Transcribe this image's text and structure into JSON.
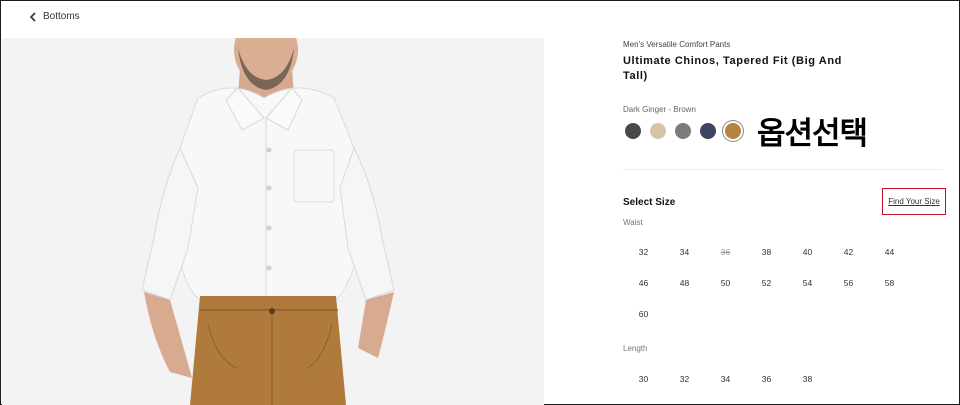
{
  "nav": {
    "back_label": "Bottoms"
  },
  "product": {
    "subtitle": "Men's Versatile Comfort Pants",
    "title": "Ultimate Chinos, Tapered Fit (Big And Tall)",
    "color_name": "Dark Ginger - Brown",
    "swatches": [
      {
        "name": "charcoal",
        "hex": "#46484b",
        "selected": false
      },
      {
        "name": "khaki",
        "hex": "#d6c3a6",
        "selected": false
      },
      {
        "name": "grey",
        "hex": "#7c7d7b",
        "selected": false
      },
      {
        "name": "navy",
        "hex": "#3d4460",
        "selected": false
      },
      {
        "name": "dark ginger",
        "hex": "#b5843f",
        "selected": true
      }
    ]
  },
  "annotation": {
    "text": "옵션선택"
  },
  "size": {
    "heading": "Select Size",
    "find_size_label": "Find Your Size",
    "waist_label": "Waist",
    "waist": [
      {
        "v": "32",
        "available": true
      },
      {
        "v": "34",
        "available": true
      },
      {
        "v": "36",
        "available": false
      },
      {
        "v": "38",
        "available": true
      },
      {
        "v": "40",
        "available": true
      },
      {
        "v": "42",
        "available": true
      },
      {
        "v": "44",
        "available": true
      },
      {
        "v": "46",
        "available": true
      },
      {
        "v": "48",
        "available": true
      },
      {
        "v": "50",
        "available": true
      },
      {
        "v": "52",
        "available": true
      },
      {
        "v": "54",
        "available": true
      },
      {
        "v": "56",
        "available": true
      },
      {
        "v": "58",
        "available": true
      },
      {
        "v": "60",
        "available": true
      }
    ],
    "length_label": "Length",
    "length": [
      {
        "v": "30",
        "available": true
      },
      {
        "v": "32",
        "available": true
      },
      {
        "v": "34",
        "available": true
      },
      {
        "v": "36",
        "available": true
      },
      {
        "v": "38",
        "available": true
      }
    ]
  },
  "colors": {
    "accent_border": "#c8102e",
    "pants": "#b07a3c",
    "shirt": "#f7f7f8"
  }
}
